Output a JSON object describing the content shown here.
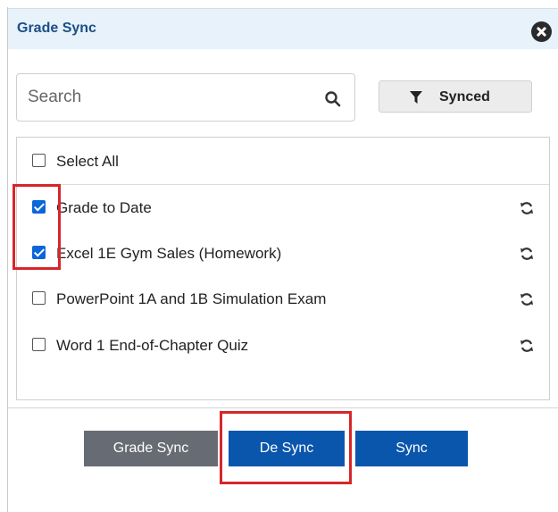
{
  "dialog": {
    "title": "Grade Sync",
    "close_icon": "close-circle-icon"
  },
  "search": {
    "placeholder": "Search",
    "value": "",
    "icon": "search-icon"
  },
  "filter": {
    "label": "Synced",
    "icon": "funnel-icon"
  },
  "list": {
    "select_all_label": "Select All",
    "select_all_checked": false,
    "items": [
      {
        "label": "Grade to Date",
        "checked": true,
        "icon": "sync-icon"
      },
      {
        "label": "Excel 1E Gym Sales (Homework)",
        "checked": true,
        "icon": "sync-icon"
      },
      {
        "label": "PowerPoint 1A and 1B Simulation Exam",
        "checked": false,
        "icon": "sync-icon"
      },
      {
        "label": "Word 1 End-of-Chapter Quiz",
        "checked": false,
        "icon": "sync-icon"
      }
    ]
  },
  "footer": {
    "grade_sync_label": "Grade Sync",
    "desync_label": "De Sync",
    "sync_label": "Sync"
  },
  "colors": {
    "header_bg": "#e7f2fb",
    "title_color": "#1c4f86",
    "primary_button": "#0a56ad",
    "secondary_button": "#676b73",
    "checkbox_checked": "#0b66d8",
    "highlight_annotation": "#d6262b"
  }
}
